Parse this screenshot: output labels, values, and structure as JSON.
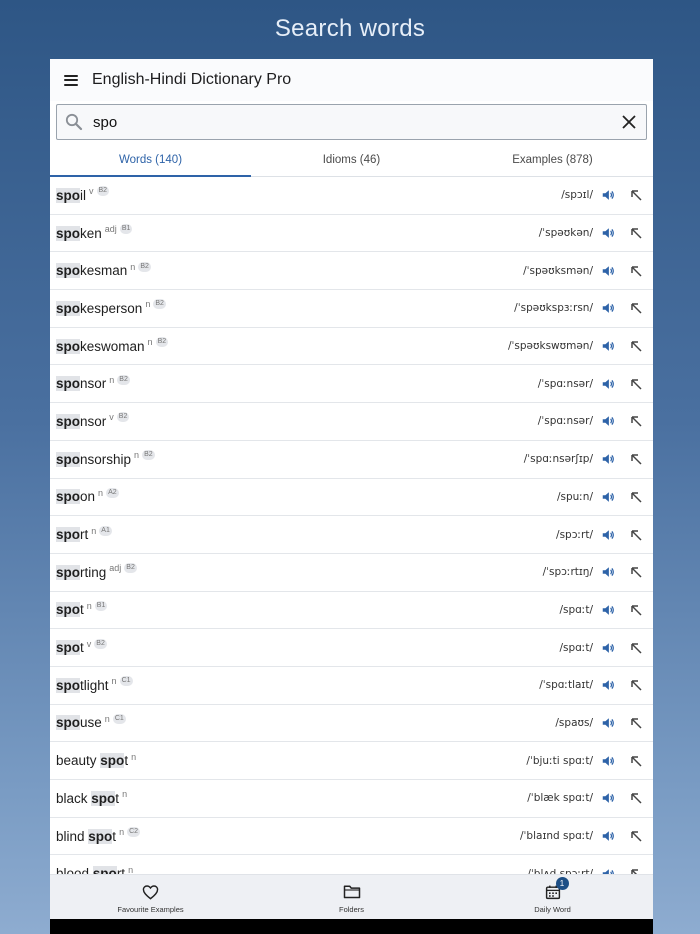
{
  "headline": "Search words",
  "app": {
    "title": "English-Hindi Dictionary Pro",
    "menu_icon": "hamburger-menu-icon"
  },
  "search": {
    "value": "spo",
    "search_icon": "magnifier-icon",
    "clear_icon": "close-icon"
  },
  "tabs": [
    {
      "label": "Words (140)",
      "active": true
    },
    {
      "label": "Idioms (46)",
      "active": false
    },
    {
      "label": "Examples (878)",
      "active": false
    }
  ],
  "words": [
    {
      "pre": "",
      "hl": "spo",
      "post": "il",
      "pos": "v",
      "level": "B2",
      "ipa": "/spɔɪl/"
    },
    {
      "pre": "",
      "hl": "spo",
      "post": "ken",
      "pos": "adj",
      "level": "B1",
      "ipa": "/ˈspəʊkən/"
    },
    {
      "pre": "",
      "hl": "spo",
      "post": "kesman",
      "pos": "n",
      "level": "B2",
      "ipa": "/ˈspəʊksmən/"
    },
    {
      "pre": "",
      "hl": "spo",
      "post": "kesperson",
      "pos": "n",
      "level": "B2",
      "ipa": "/ˈspəʊkspɜːrsn/"
    },
    {
      "pre": "",
      "hl": "spo",
      "post": "keswoman",
      "pos": "n",
      "level": "B2",
      "ipa": "/ˈspəʊkswʊmən/"
    },
    {
      "pre": "",
      "hl": "spo",
      "post": "nsor",
      "pos": "n",
      "level": "B2",
      "ipa": "/ˈspɑːnsər/"
    },
    {
      "pre": "",
      "hl": "spo",
      "post": "nsor",
      "pos": "v",
      "level": "B2",
      "ipa": "/ˈspɑːnsər/"
    },
    {
      "pre": "",
      "hl": "spo",
      "post": "nsorship",
      "pos": "n",
      "level": "B2",
      "ipa": "/ˈspɑːnsərʃɪp/"
    },
    {
      "pre": "",
      "hl": "spo",
      "post": "on",
      "pos": "n",
      "level": "A2",
      "ipa": "/spuːn/"
    },
    {
      "pre": "",
      "hl": "spo",
      "post": "rt",
      "pos": "n",
      "level": "A1",
      "ipa": "/spɔːrt/"
    },
    {
      "pre": "",
      "hl": "spo",
      "post": "rting",
      "pos": "adj",
      "level": "B2",
      "ipa": "/ˈspɔːrtɪŋ/"
    },
    {
      "pre": "",
      "hl": "spo",
      "post": "t",
      "pos": "n",
      "level": "B1",
      "ipa": "/spɑːt/"
    },
    {
      "pre": "",
      "hl": "spo",
      "post": "t",
      "pos": "v",
      "level": "B2",
      "ipa": "/spɑːt/"
    },
    {
      "pre": "",
      "hl": "spo",
      "post": "tlight",
      "pos": "n",
      "level": "C1",
      "ipa": "/ˈspɑːtlaɪt/"
    },
    {
      "pre": "",
      "hl": "spo",
      "post": "use",
      "pos": "n",
      "level": "C1",
      "ipa": "/spaʊs/"
    },
    {
      "pre": "beauty ",
      "hl": "spo",
      "post": "t",
      "pos": "n",
      "level": "",
      "ipa": "/ˈbjuːti spɑːt/"
    },
    {
      "pre": "black ",
      "hl": "spo",
      "post": "t",
      "pos": "n",
      "level": "",
      "ipa": "/ˈblæk spɑːt/"
    },
    {
      "pre": "blind ",
      "hl": "spo",
      "post": "t",
      "pos": "n",
      "level": "C2",
      "ipa": "/ˈblaɪnd spɑːt/"
    },
    {
      "pre": "blood ",
      "hl": "spo",
      "post": "rt",
      "pos": "n",
      "level": "",
      "ipa": "/ˈblʌd spɔːrt/"
    }
  ],
  "bottom_nav": [
    {
      "label": "Favourite Examples",
      "icon": "heart-icon"
    },
    {
      "label": "Folders",
      "icon": "folder-icon"
    },
    {
      "label": "Daily Word",
      "icon": "calendar-icon",
      "badge": "1"
    }
  ]
}
